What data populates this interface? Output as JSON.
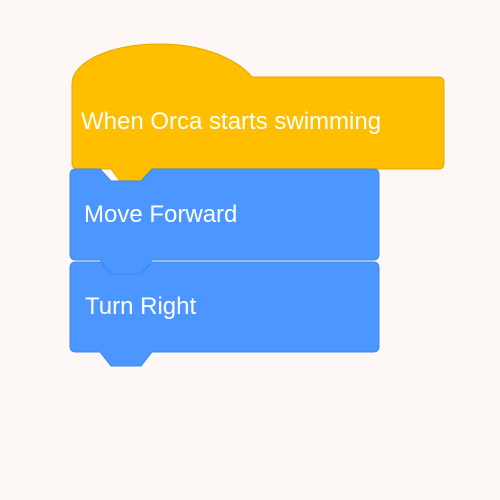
{
  "workspace": {
    "background_color": "#fdf8f6"
  },
  "script": {
    "hat_block": {
      "label": "When Orca starts swimming",
      "category": "event",
      "fill_color": "#ffbf00",
      "stroke_color": "#e6a800"
    },
    "blocks": [
      {
        "label": "Move Forward",
        "category": "motion",
        "fill_color": "#4c97ff",
        "stroke_color": "#3d86ea"
      },
      {
        "label": "Turn Right",
        "category": "motion",
        "fill_color": "#4c97ff",
        "stroke_color": "#3d86ea"
      }
    ]
  }
}
